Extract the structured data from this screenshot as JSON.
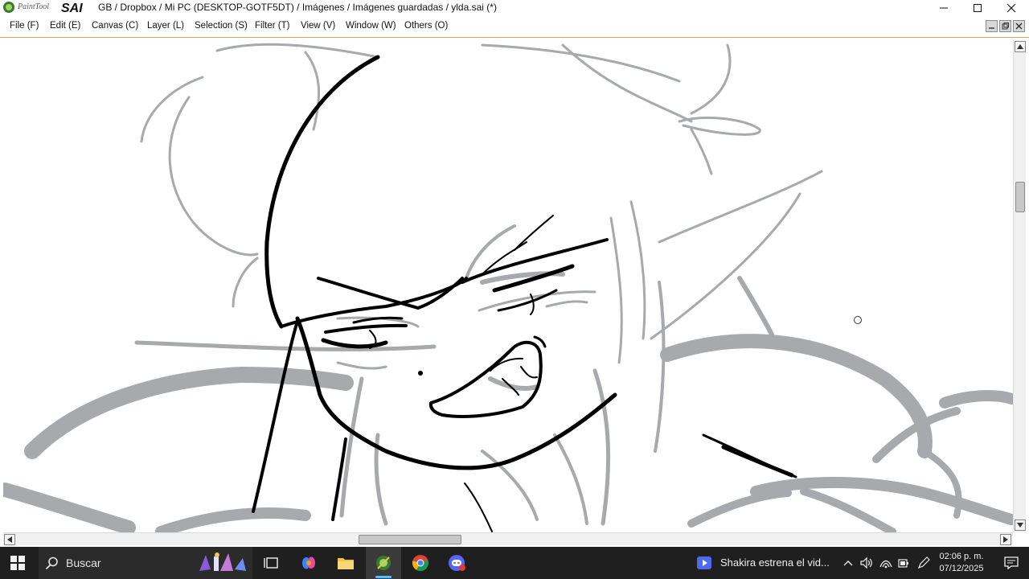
{
  "app": {
    "logo_text_small": "PaintTool",
    "logo_text_big": "SAI",
    "title": "GB / Dropbox / Mi PC (DESKTOP-GOTF5DT) / Imágenes / Imágenes guardadas / ylda.sai (*)"
  },
  "menu": {
    "items": [
      {
        "label": "File (F)"
      },
      {
        "label": "Edit (E)"
      },
      {
        "label": "Canvas (C)"
      },
      {
        "label": "Layer (L)"
      },
      {
        "label": "Selection (S)"
      },
      {
        "label": "Filter (T)"
      },
      {
        "label": "View (V)"
      },
      {
        "label": "Window (W)"
      },
      {
        "label": "Others (O)"
      }
    ]
  },
  "canvas": {
    "content": "sketch of an elf character with pointed ears and a grin",
    "scroll_vertical_fraction": 0.3,
    "scroll_horizontal_fraction": 0.4
  },
  "taskbar": {
    "search_placeholder": "Buscar",
    "news_text": "Shakira estrena el vid...",
    "time": "02:06 p. m.",
    "date": "07/12/2025"
  },
  "colors": {
    "sketch_gray": "#a7a9ac",
    "lineart_black": "#000000",
    "taskbar_bg": "#1f1f1f",
    "accent_border": "#e8a060"
  }
}
